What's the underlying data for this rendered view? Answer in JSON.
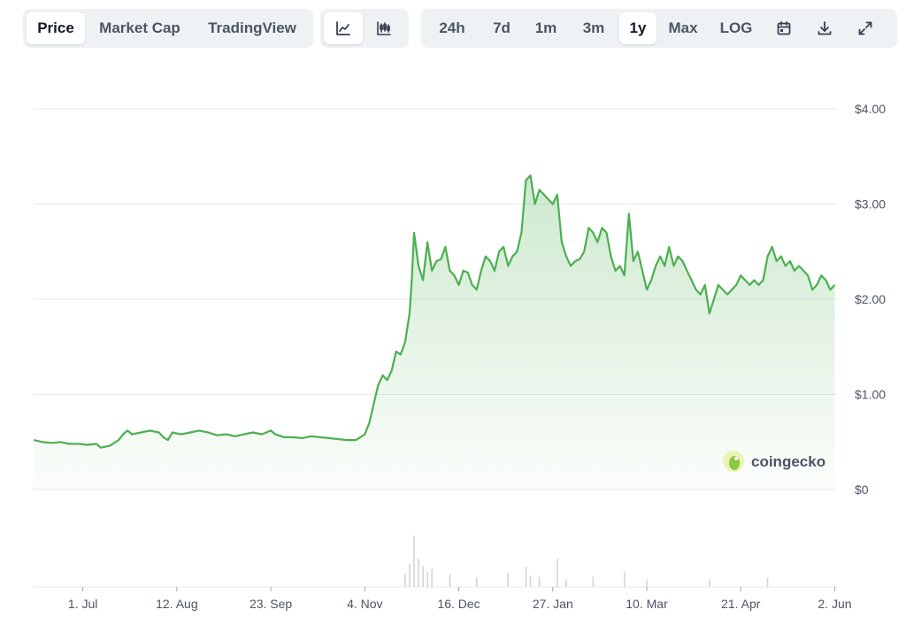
{
  "toolbar": {
    "view_tabs": [
      {
        "label": "Price",
        "active": true
      },
      {
        "label": "Market Cap",
        "active": false
      },
      {
        "label": "TradingView",
        "active": false
      }
    ],
    "chart_type_buttons": [
      {
        "icon": "line-chart-icon",
        "active": true
      },
      {
        "icon": "candlestick-chart-icon",
        "active": false
      }
    ],
    "ranges": [
      {
        "label": "24h",
        "active": false
      },
      {
        "label": "7d",
        "active": false
      },
      {
        "label": "1m",
        "active": false
      },
      {
        "label": "3m",
        "active": false
      },
      {
        "label": "1y",
        "active": true
      },
      {
        "label": "Max",
        "active": false
      },
      {
        "label": "LOG",
        "active": false
      }
    ],
    "action_icons": [
      "calendar-icon",
      "download-icon",
      "fullscreen-icon"
    ]
  },
  "watermark": "coingecko",
  "colors": {
    "line": "#4caf50",
    "grid": "#e5e7eb",
    "active_bg": "#ffffff",
    "group_bg": "#eff2f5"
  },
  "chart_data": {
    "type": "area",
    "y_tick_labels": [
      "$0",
      "$1.00",
      "$2.00",
      "$3.00",
      "$4.00"
    ],
    "y_ticks": [
      0,
      1,
      2,
      3,
      4
    ],
    "ylim": [
      0,
      4.2
    ],
    "x_tick_labels": [
      "1. Jul",
      "12. Aug",
      "23. Sep",
      "4. Nov",
      "16. Dec",
      "27. Jan",
      "10. Mar",
      "21. Apr",
      "2. Jun"
    ],
    "x_ticks": [
      6,
      48,
      90,
      132,
      174,
      216,
      258,
      300,
      342
    ],
    "xlim": [
      -16,
      343
    ],
    "series": [
      {
        "values": [
          [
            -16,
            0.52
          ],
          [
            -12,
            0.5
          ],
          [
            -8,
            0.49
          ],
          [
            -4,
            0.5
          ],
          [
            0,
            0.48
          ],
          [
            4,
            0.48
          ],
          [
            8,
            0.47
          ],
          [
            12,
            0.48
          ],
          [
            14,
            0.44
          ],
          [
            18,
            0.46
          ],
          [
            22,
            0.52
          ],
          [
            24,
            0.58
          ],
          [
            26,
            0.62
          ],
          [
            28,
            0.58
          ],
          [
            32,
            0.6
          ],
          [
            36,
            0.62
          ],
          [
            40,
            0.6
          ],
          [
            42,
            0.55
          ],
          [
            44,
            0.52
          ],
          [
            46,
            0.6
          ],
          [
            50,
            0.58
          ],
          [
            54,
            0.6
          ],
          [
            58,
            0.62
          ],
          [
            62,
            0.6
          ],
          [
            66,
            0.57
          ],
          [
            70,
            0.58
          ],
          [
            74,
            0.56
          ],
          [
            78,
            0.58
          ],
          [
            82,
            0.6
          ],
          [
            86,
            0.58
          ],
          [
            88,
            0.6
          ],
          [
            90,
            0.62
          ],
          [
            92,
            0.58
          ],
          [
            96,
            0.55
          ],
          [
            100,
            0.55
          ],
          [
            104,
            0.54
          ],
          [
            108,
            0.56
          ],
          [
            112,
            0.55
          ],
          [
            116,
            0.54
          ],
          [
            120,
            0.53
          ],
          [
            124,
            0.52
          ],
          [
            128,
            0.52
          ],
          [
            130,
            0.55
          ],
          [
            132,
            0.58
          ],
          [
            134,
            0.7
          ],
          [
            136,
            0.9
          ],
          [
            138,
            1.1
          ],
          [
            140,
            1.2
          ],
          [
            142,
            1.15
          ],
          [
            144,
            1.25
          ],
          [
            146,
            1.45
          ],
          [
            148,
            1.42
          ],
          [
            150,
            1.55
          ],
          [
            152,
            1.85
          ],
          [
            153,
            2.2
          ],
          [
            154,
            2.7
          ],
          [
            156,
            2.35
          ],
          [
            158,
            2.2
          ],
          [
            160,
            2.6
          ],
          [
            162,
            2.3
          ],
          [
            164,
            2.4
          ],
          [
            166,
            2.42
          ],
          [
            168,
            2.55
          ],
          [
            170,
            2.3
          ],
          [
            172,
            2.25
          ],
          [
            174,
            2.15
          ],
          [
            176,
            2.3
          ],
          [
            178,
            2.28
          ],
          [
            180,
            2.15
          ],
          [
            182,
            2.1
          ],
          [
            184,
            2.3
          ],
          [
            186,
            2.45
          ],
          [
            188,
            2.4
          ],
          [
            190,
            2.3
          ],
          [
            192,
            2.5
          ],
          [
            194,
            2.55
          ],
          [
            196,
            2.35
          ],
          [
            198,
            2.45
          ],
          [
            200,
            2.5
          ],
          [
            202,
            2.7
          ],
          [
            204,
            3.25
          ],
          [
            206,
            3.3
          ],
          [
            208,
            3.0
          ],
          [
            210,
            3.15
          ],
          [
            212,
            3.1
          ],
          [
            214,
            3.05
          ],
          [
            216,
            3.0
          ],
          [
            218,
            3.1
          ],
          [
            220,
            2.6
          ],
          [
            222,
            2.45
          ],
          [
            224,
            2.35
          ],
          [
            226,
            2.4
          ],
          [
            228,
            2.42
          ],
          [
            230,
            2.5
          ],
          [
            232,
            2.75
          ],
          [
            234,
            2.7
          ],
          [
            236,
            2.6
          ],
          [
            238,
            2.75
          ],
          [
            240,
            2.7
          ],
          [
            242,
            2.45
          ],
          [
            244,
            2.3
          ],
          [
            246,
            2.35
          ],
          [
            248,
            2.25
          ],
          [
            250,
            2.9
          ],
          [
            252,
            2.4
          ],
          [
            254,
            2.5
          ],
          [
            256,
            2.3
          ],
          [
            258,
            2.1
          ],
          [
            260,
            2.2
          ],
          [
            262,
            2.35
          ],
          [
            264,
            2.45
          ],
          [
            266,
            2.35
          ],
          [
            268,
            2.55
          ],
          [
            270,
            2.35
          ],
          [
            272,
            2.45
          ],
          [
            274,
            2.4
          ],
          [
            276,
            2.3
          ],
          [
            278,
            2.2
          ],
          [
            280,
            2.1
          ],
          [
            282,
            2.05
          ],
          [
            284,
            2.15
          ],
          [
            286,
            1.85
          ],
          [
            288,
            2.0
          ],
          [
            290,
            2.15
          ],
          [
            292,
            2.1
          ],
          [
            294,
            2.05
          ],
          [
            296,
            2.1
          ],
          [
            298,
            2.15
          ],
          [
            300,
            2.25
          ],
          [
            302,
            2.2
          ],
          [
            304,
            2.15
          ],
          [
            306,
            2.2
          ],
          [
            308,
            2.15
          ],
          [
            310,
            2.2
          ],
          [
            312,
            2.45
          ],
          [
            314,
            2.55
          ],
          [
            316,
            2.4
          ],
          [
            318,
            2.45
          ],
          [
            320,
            2.35
          ],
          [
            322,
            2.4
          ],
          [
            324,
            2.3
          ],
          [
            326,
            2.35
          ],
          [
            328,
            2.3
          ],
          [
            330,
            2.25
          ],
          [
            332,
            2.1
          ],
          [
            334,
            2.15
          ],
          [
            336,
            2.25
          ],
          [
            338,
            2.2
          ],
          [
            340,
            2.1
          ],
          [
            342,
            2.15
          ]
        ]
      }
    ],
    "volume": [
      [
        150,
        0.25
      ],
      [
        152,
        0.45
      ],
      [
        154,
        1.0
      ],
      [
        156,
        0.55
      ],
      [
        158,
        0.4
      ],
      [
        160,
        0.3
      ],
      [
        162,
        0.35
      ],
      [
        170,
        0.25
      ],
      [
        182,
        0.18
      ],
      [
        196,
        0.28
      ],
      [
        204,
        0.4
      ],
      [
        206,
        0.22
      ],
      [
        210,
        0.2
      ],
      [
        218,
        0.55
      ],
      [
        222,
        0.15
      ],
      [
        234,
        0.2
      ],
      [
        248,
        0.3
      ],
      [
        258,
        0.15
      ],
      [
        286,
        0.15
      ],
      [
        312,
        0.18
      ]
    ],
    "grid": true
  }
}
